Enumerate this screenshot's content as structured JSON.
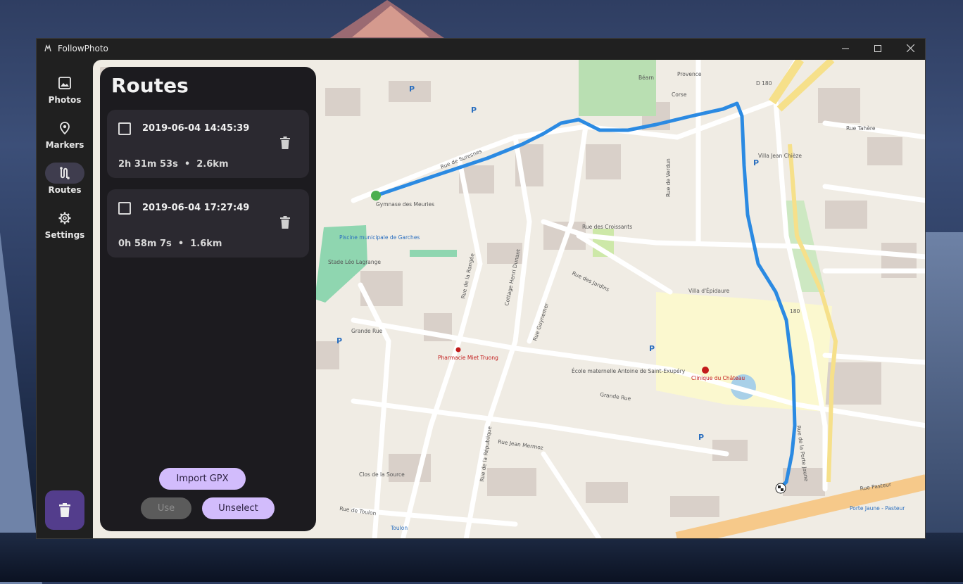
{
  "window": {
    "title": "FollowPhoto"
  },
  "nav": {
    "items": [
      {
        "label": "Photos",
        "icon": "image-icon",
        "active": false
      },
      {
        "label": "Markers",
        "icon": "map-pin-icon",
        "active": false
      },
      {
        "label": "Routes",
        "icon": "route-icon",
        "active": true
      },
      {
        "label": "Settings",
        "icon": "gear-icon",
        "active": false
      }
    ],
    "fab_icon": "trash-icon"
  },
  "panel": {
    "title": "Routes",
    "routes": [
      {
        "date": "2019-06-04 14:45:39",
        "duration": "2h 31m 53s",
        "distance": "2.6km",
        "checked": false
      },
      {
        "date": "2019-06-04 17:27:49",
        "duration": "0h 58m 7s",
        "distance": "1.6km",
        "checked": false
      }
    ],
    "separator": "•",
    "import_label": "Import GPX",
    "use_label": "Use",
    "unselect_label": "Unselect"
  },
  "map": {
    "labels": {
      "rue_croissants": "Rue des Croissants",
      "rue_jardins": "Rue des Jardins",
      "grande_rue_1": "Grande Rue",
      "grande_rue_2": "Grande Rue",
      "rue_jean_mermoz": "Rue Jean Mermoz",
      "rue_toulon": "Rue de Toulon",
      "rue_pasteur": "Rue Pasteur",
      "rue_tahere": "Rue Tahère",
      "rue_suresnes": "Rue de Suresnes",
      "gymnase": "Gymnase des Meuries",
      "piscine": "Piscine municipale de Garches",
      "stade": "Stade Léo Lagrange",
      "villa_epidaure": "Villa d'Épidaure",
      "villa_jean_chieze": "Villa Jean Chièze",
      "clinique": "Clinique du Château",
      "pharmacie": "Pharmacie Miet Truong",
      "ecole": "École maternelle Antoine de Saint-Exupéry",
      "clos_source": "Clos de la Source",
      "rue_verdun": "Rue de Verdun",
      "rue_rangee": "Rue de la Rangée",
      "cottage": "Cottage Henri Dunant",
      "rue_guynemer": "Rue Guynemer",
      "rue_republique": "Rue de la République",
      "rue_porte_jaune": "Rue de la Porte Jaune",
      "provence": "Provence",
      "corse": "Corse",
      "bearn": "Béarn",
      "d180": "D 180",
      "n180": "180",
      "toulon": "Toulon",
      "porte_jaune": "Porte Jaune - Pasteur"
    }
  },
  "colors": {
    "accent": "#d2bcfc",
    "fab": "#533d8c",
    "route": "#2b8ae2",
    "start_marker": "#4caf50"
  }
}
